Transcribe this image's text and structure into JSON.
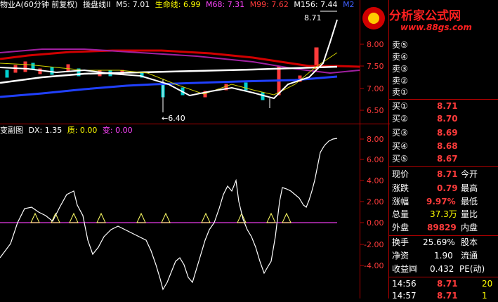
{
  "main_header": {
    "stock": "物业A(60分钟 前复权)",
    "indicator": "操盘线II",
    "m5": "M5: 7.01",
    "life": "生命线: 6.99",
    "m68": "M68: 7.31",
    "m99": "M99: 7.62",
    "m156": "M156: 7.44",
    "m2": "M2"
  },
  "main_axis": [
    "8.00",
    "7.50",
    "7.00",
    "6.50"
  ],
  "main_labels": {
    "high": "8.71",
    "low": "←6.40"
  },
  "sub_header": {
    "name": "变副图",
    "dx": "DX: 1.35",
    "zhi": "质: 0.00",
    "bian": "变: 0.00"
  },
  "sub_axis": [
    "8.00",
    "6.00",
    "4.00",
    "2.00",
    "0.00",
    "-2.00",
    "-4.00"
  ],
  "watermark": {
    "title": "分析家公式网",
    "url": "www.88gs.com"
  },
  "sell_orders": [
    {
      "label": "卖⑤"
    },
    {
      "label": "卖④"
    },
    {
      "label": "卖③"
    },
    {
      "label": "卖②"
    },
    {
      "label": "卖①"
    }
  ],
  "buy_orders": [
    {
      "label": "买①",
      "price": "8.71"
    },
    {
      "label": "买②",
      "price": "8.70"
    },
    {
      "label": "买③",
      "price": "8.69"
    },
    {
      "label": "买④",
      "price": "8.68"
    },
    {
      "label": "买⑤",
      "price": "8.67"
    }
  ],
  "quote": [
    {
      "l": "现价",
      "v": "8.71",
      "r": "今开",
      "vcolor": "#ff3b3b"
    },
    {
      "l": "涨跌",
      "v": "0.79",
      "r": "最高",
      "vcolor": "#ff3b3b"
    },
    {
      "l": "涨幅",
      "v": "9.97%",
      "r": "最低",
      "vcolor": "#ff3b3b"
    },
    {
      "l": "总量",
      "v": "37.3万",
      "r": "量比",
      "vcolor": "#ffff00"
    },
    {
      "l": "外盘",
      "v": "89829",
      "r": "内盘",
      "vcolor": "#ff3b3b"
    },
    {
      "l": "换手",
      "v": "25.69%",
      "r": "股本",
      "vcolor": "#ffffff"
    },
    {
      "l": "净资",
      "v": "1.90",
      "r": "流通",
      "vcolor": "#ffffff"
    },
    {
      "l": "收益㈣",
      "v": "0.432",
      "r": "PE(动)",
      "vcolor": "#ffffff"
    }
  ],
  "ticks": [
    {
      "time": "14:56",
      "price": "8.71",
      "vol": "20"
    },
    {
      "time": "14:57",
      "price": "8.71",
      "vol": "1"
    }
  ],
  "colors": {
    "red": "#ff3b3b",
    "yellow": "#ffff00",
    "magenta": "#ff44ff",
    "frame": "#b00000",
    "blue": "#0040ff"
  }
}
